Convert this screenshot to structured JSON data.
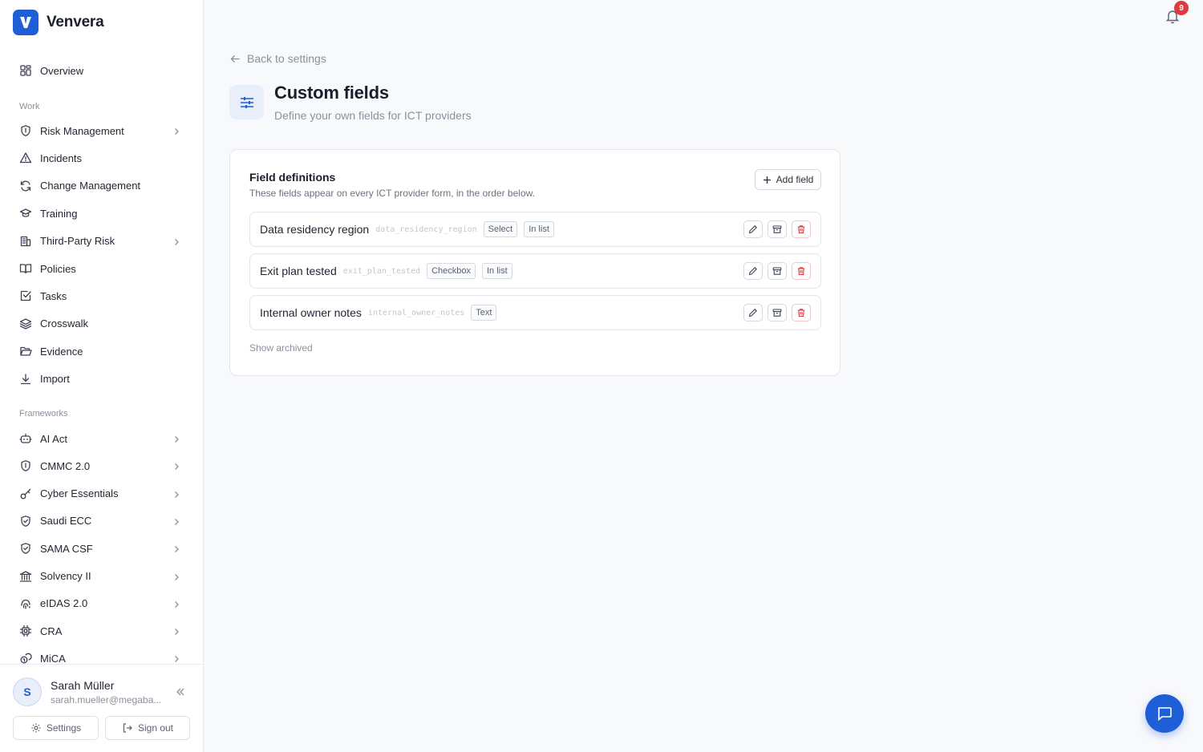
{
  "brand": {
    "name": "Venvera",
    "accent": "#1e5fd8"
  },
  "sidebar": {
    "overview": {
      "label": "Overview",
      "icon": "grid-icon"
    },
    "work_title": "Work",
    "work_items": [
      {
        "label": "Risk Management",
        "icon": "shield-icon",
        "has_children": true
      },
      {
        "label": "Incidents",
        "icon": "alert-triangle-icon",
        "has_children": false
      },
      {
        "label": "Change Management",
        "icon": "refresh-icon",
        "has_children": false
      },
      {
        "label": "Training",
        "icon": "graduation-cap-icon",
        "has_children": false
      },
      {
        "label": "Third-Party Risk",
        "icon": "building-icon",
        "has_children": true
      },
      {
        "label": "Policies",
        "icon": "book-open-icon",
        "has_children": false
      },
      {
        "label": "Tasks",
        "icon": "checkbox-icon",
        "has_children": false
      },
      {
        "label": "Crosswalk",
        "icon": "layers-icon",
        "has_children": false
      },
      {
        "label": "Evidence",
        "icon": "folder-open-icon",
        "has_children": false
      },
      {
        "label": "Import",
        "icon": "download-icon",
        "has_children": false
      }
    ],
    "frameworks_title": "Frameworks",
    "framework_items": [
      {
        "label": "AI Act",
        "icon": "bot-icon"
      },
      {
        "label": "CMMC 2.0",
        "icon": "shield-icon"
      },
      {
        "label": "Cyber Essentials",
        "icon": "key-icon"
      },
      {
        "label": "Saudi ECC",
        "icon": "shield-check-icon"
      },
      {
        "label": "SAMA CSF",
        "icon": "shield-check-icon"
      },
      {
        "label": "Solvency II",
        "icon": "landmark-icon"
      },
      {
        "label": "eIDAS 2.0",
        "icon": "fingerprint-icon"
      },
      {
        "label": "CRA",
        "icon": "chip-icon"
      },
      {
        "label": "MiCA",
        "icon": "coins-icon"
      }
    ]
  },
  "user": {
    "initial": "S",
    "name": "Sarah Müller",
    "email": "sarah.mueller@megaba...",
    "settings_label": "Settings",
    "signout_label": "Sign out"
  },
  "notifications": {
    "count": "9"
  },
  "page": {
    "back_label": "Back to settings",
    "title": "Custom fields",
    "subtitle": "Define your own fields for ICT providers"
  },
  "card": {
    "title": "Field definitions",
    "subtitle": "These fields appear on every ICT provider form, in the order below.",
    "add_label": "Add field",
    "show_archived_label": "Show archived",
    "fields": [
      {
        "name": "Data residency region",
        "key": "data_residency_region",
        "tags": [
          "Select",
          "In list"
        ]
      },
      {
        "name": "Exit plan tested",
        "key": "exit_plan_tested",
        "tags": [
          "Checkbox",
          "In list"
        ]
      },
      {
        "name": "Internal owner notes",
        "key": "internal_owner_notes",
        "tags": [
          "Text"
        ]
      }
    ]
  }
}
